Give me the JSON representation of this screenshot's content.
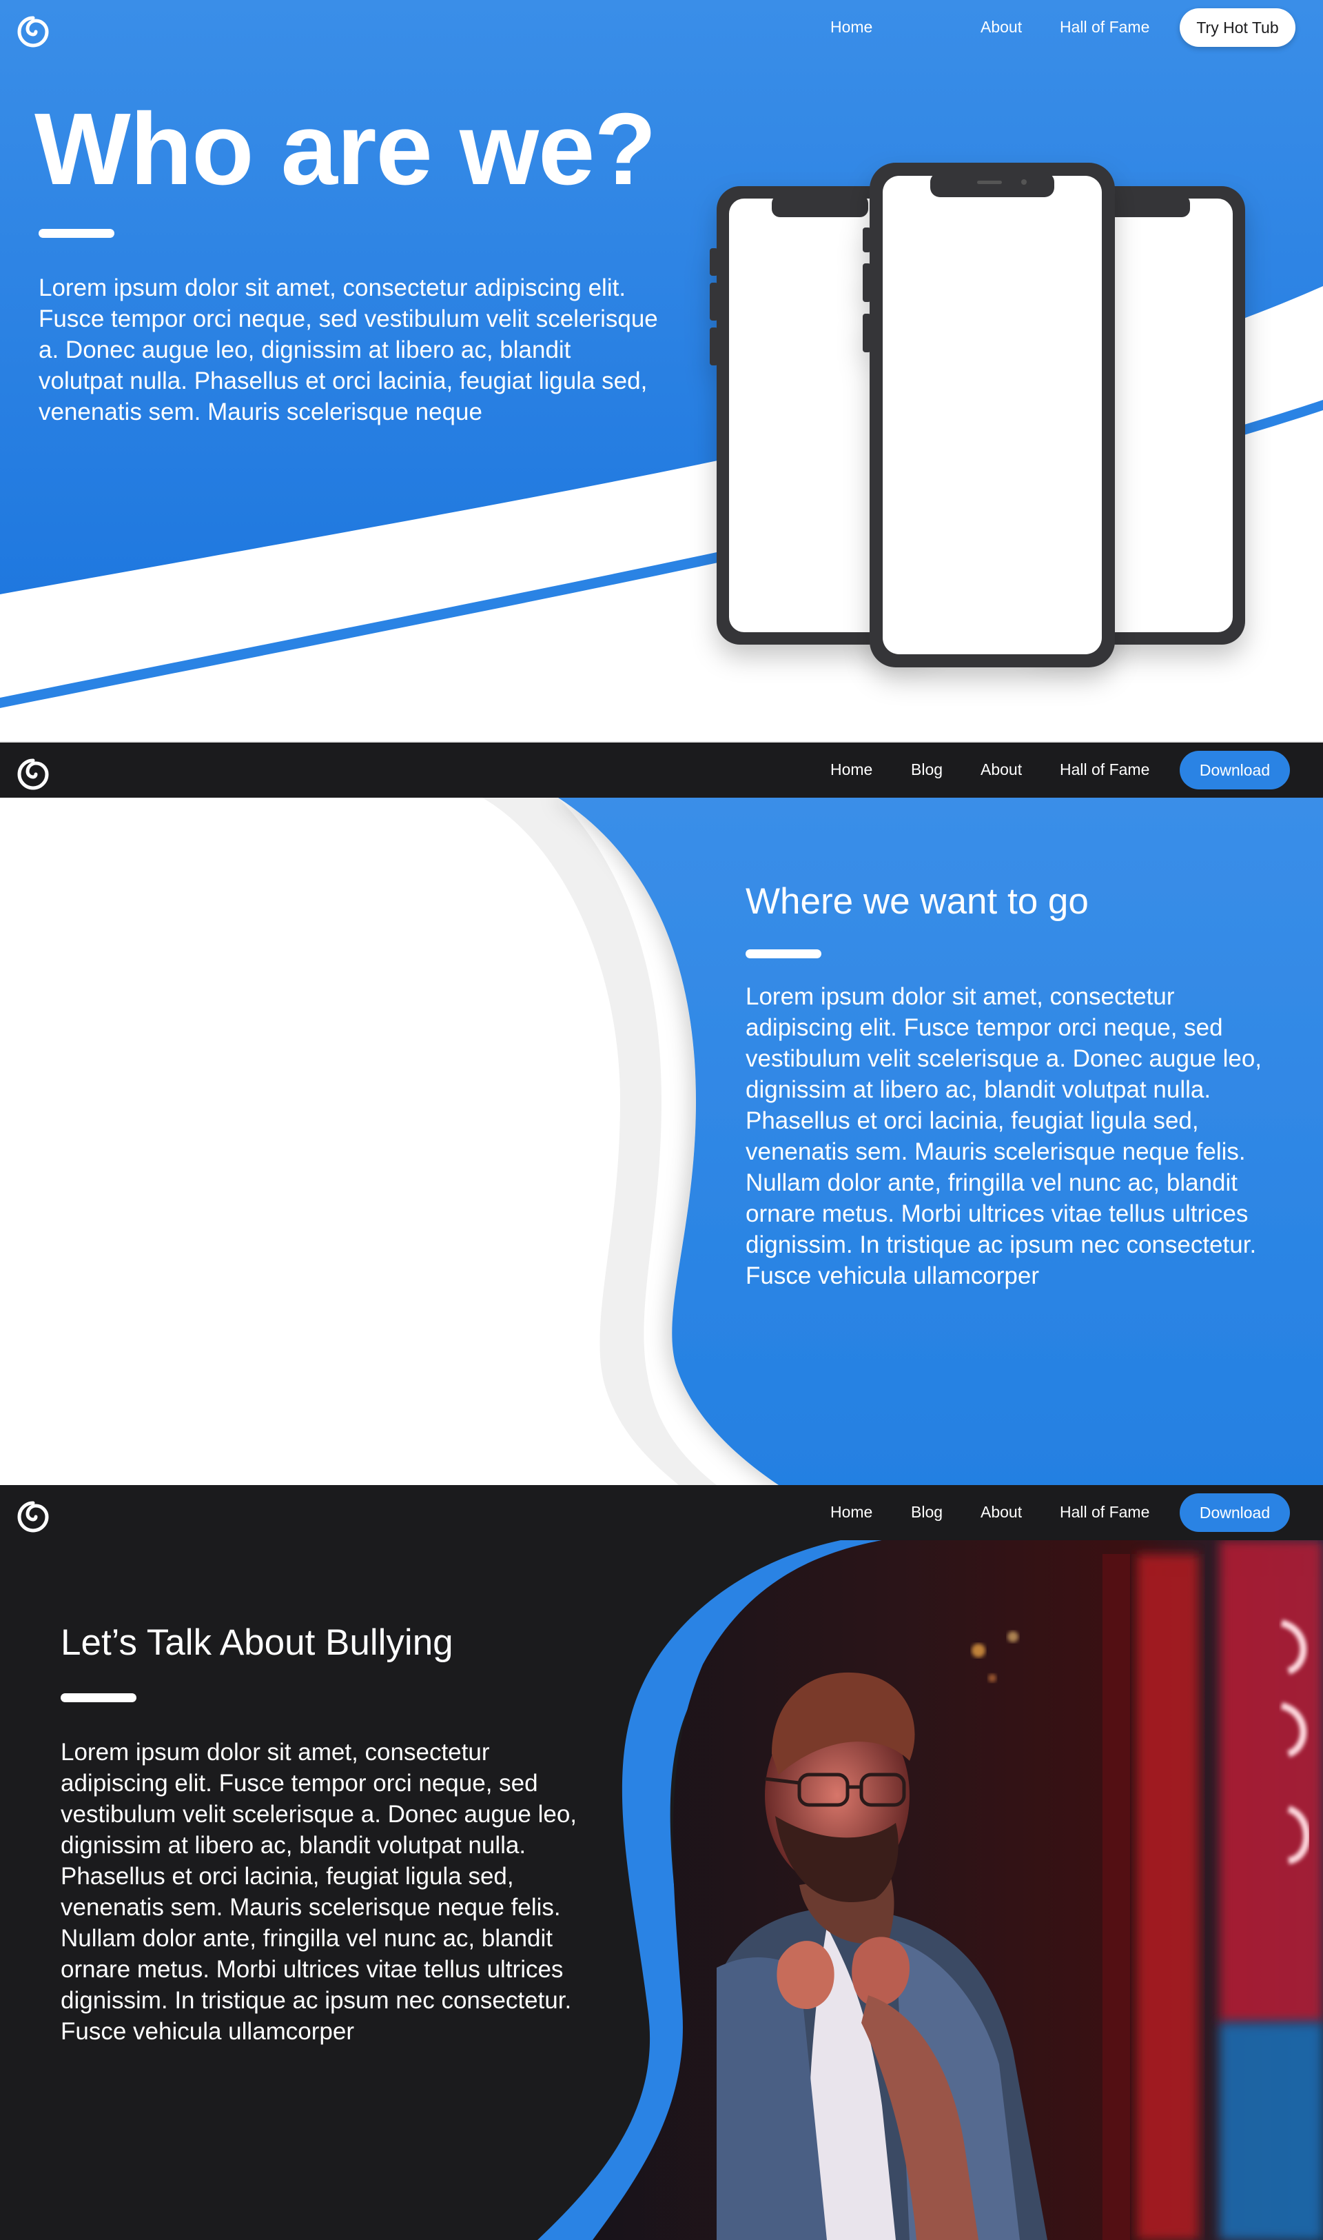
{
  "colors": {
    "accent": "#2a83e4",
    "dark": "#1b1b1d",
    "white": "#ffffff"
  },
  "hero": {
    "nav": {
      "logo_icon": "spiral-logo-icon",
      "links": [
        "Home",
        "About",
        "Hall of Fame"
      ],
      "cta_label": "Try Hot Tub"
    },
    "title": "Who are we?",
    "body": "Lorem ipsum dolor sit amet, consectetur adipiscing elit. Fusce tempor orci neque, sed vestibulum velit scelerisque a. Donec augue leo, dignissim at libero ac, blandit volutpat nulla. Phasellus et orci lacinia, feugiat ligula sed, venenatis sem. Mauris scelerisque neque"
  },
  "vision": {
    "nav": {
      "logo_icon": "spiral-logo-icon",
      "links": [
        "Home",
        "Blog",
        "About",
        "Hall of Fame"
      ],
      "cta_label": "Download"
    },
    "title": "Where we want to go",
    "body": "Lorem ipsum dolor sit amet, consectetur adipiscing elit. Fusce tempor orci neque, sed vestibulum velit scelerisque a. Donec augue leo, dignissim at libero ac, blandit volutpat nulla. Phasellus et orci lacinia, feugiat ligula sed, venenatis sem. Mauris scelerisque neque felis. Nullam dolor ante, fringilla vel nunc ac, blandit ornare metus. Morbi ultrices vitae tellus ultrices dignissim. In tristique ac ipsum nec consectetur. Fusce vehicula ullamcorper"
  },
  "bullying": {
    "nav": {
      "logo_icon": "spiral-logo-icon",
      "links": [
        "Home",
        "Blog",
        "About",
        "Hall of Fame"
      ],
      "cta_label": "Download"
    },
    "title": "Let’s Talk About Bullying",
    "body": "Lorem ipsum dolor sit amet, consectetur adipiscing elit. Fusce tempor orci neque, sed vestibulum velit scelerisque a. Donec augue leo, dignissim at libero ac, blandit volutpat nulla. Phasellus et orci lacinia, feugiat ligula sed, venenatis sem. Mauris scelerisque neque felis. Nullam dolor ante, fringilla vel nunc ac, blandit ornare metus. Morbi ultrices vitae tellus ultrices dignissim. In tristique ac ipsum nec consectetur. Fusce vehicula ullamcorper"
  }
}
